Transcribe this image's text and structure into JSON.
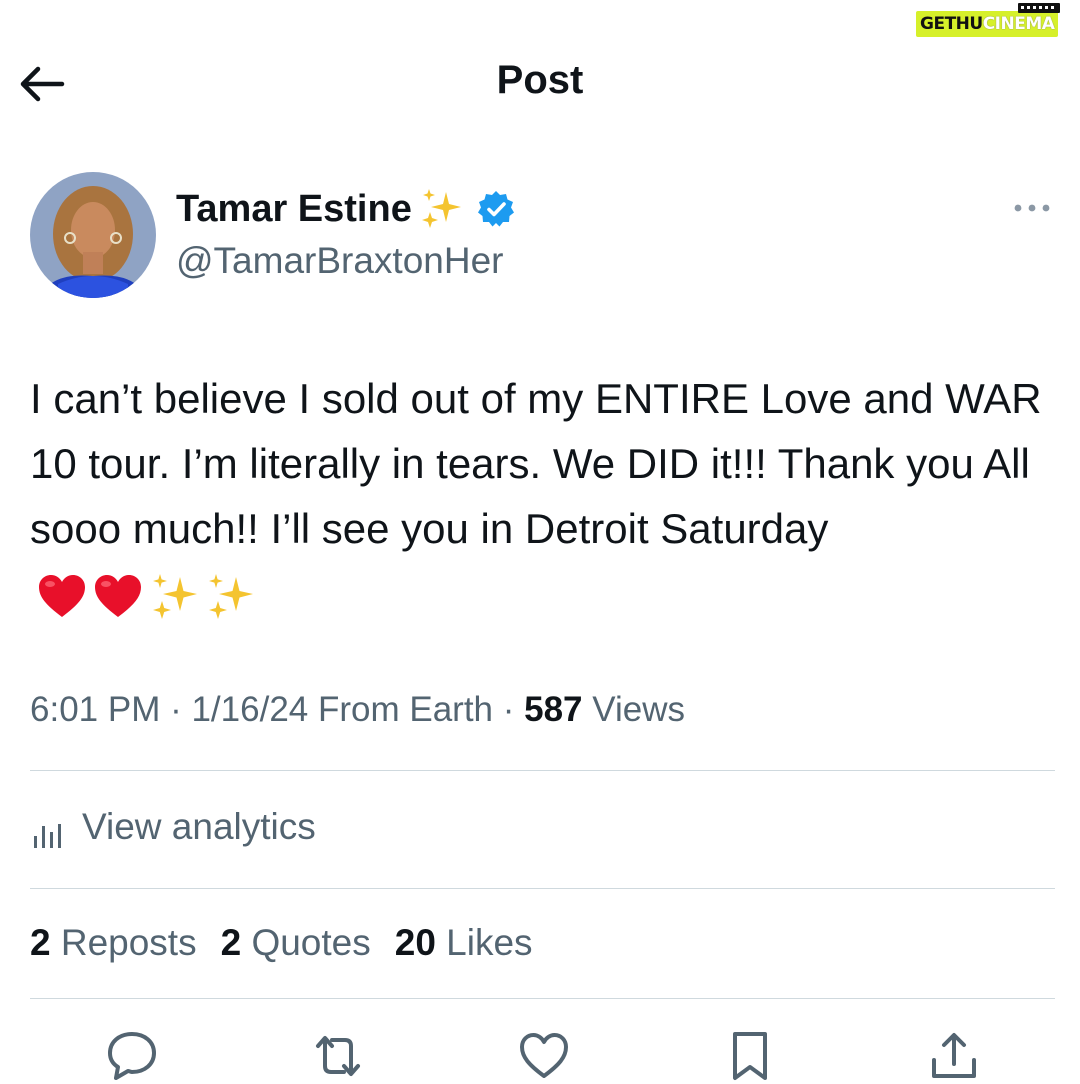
{
  "watermark": {
    "part1": "GETHU",
    "part2": "CINEMA"
  },
  "header": {
    "title": "Post",
    "back_icon": "arrow-left-icon"
  },
  "author": {
    "name": "Tamar Estine",
    "handle": "@TamarBraxtonHer",
    "verified": true,
    "badge_color": "#1d9bf0"
  },
  "post": {
    "text": "I can’t believe I sold out of my ENTIRE Love and WAR 10 tour. I’m literally in tears. We DID it!!! Thank you All sooo much!! I’ll see you in Detroit Saturday",
    "emojis": [
      "red-heart-icon",
      "red-heart-icon",
      "sparkles-icon",
      "sparkles-icon"
    ]
  },
  "meta": {
    "time": "6:01 PM",
    "sep1": " · ",
    "date": "1/16/24",
    "source": " From Earth",
    "sep2": " · ",
    "views_count": "587",
    "views_label": " Views"
  },
  "analytics": {
    "label": "View analytics"
  },
  "stats": {
    "reposts_count": "2",
    "reposts_label": " Reposts",
    "quotes_count": "2",
    "quotes_label": " Quotes",
    "likes_count": "20",
    "likes_label": " Likes"
  },
  "actions": [
    "reply-icon",
    "repost-icon",
    "like-icon",
    "bookmark-icon",
    "share-icon"
  ],
  "colors": {
    "text": "#0f1419",
    "secondary": "#536471",
    "divider": "#cfd9de",
    "accent": "#1d9bf0"
  }
}
